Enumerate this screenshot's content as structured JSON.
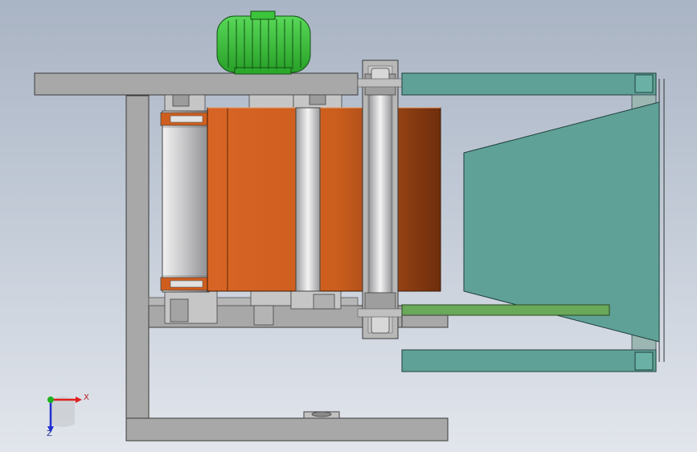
{
  "viewport": {
    "background_top": "#a9b4c4",
    "background_bottom": "#e2e6ec"
  },
  "colors": {
    "frame": "#a8a8a8",
    "frame_stroke": "#3a3a3a",
    "motor": "#3cc43c",
    "belt": "#d2601e",
    "hopper": "#5fa196",
    "plate": "#6aa85a",
    "roller": "#d4d4d6",
    "axis_x": "#e02020",
    "axis_y": "#20b020",
    "axis_z": "#2030d0"
  },
  "icons": {
    "triad": "coordinate-triad-icon"
  },
  "triad": {
    "x_label": "X",
    "z_label": "Z"
  }
}
